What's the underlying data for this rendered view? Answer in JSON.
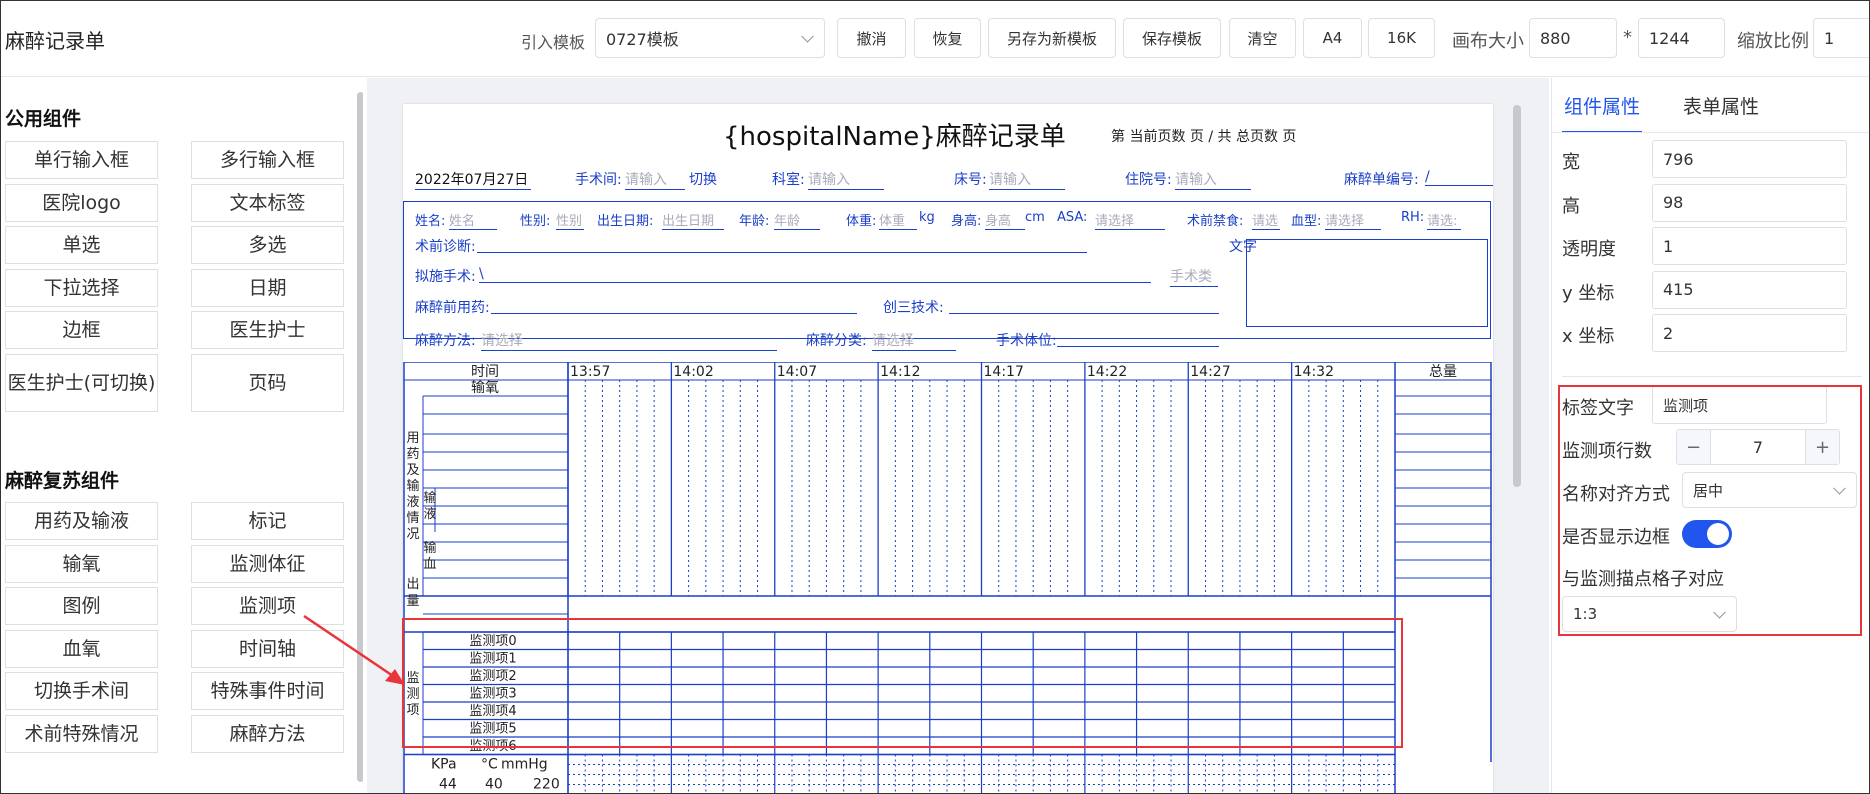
{
  "header": {
    "title": "麻醉记录单",
    "template_label": "引入模板",
    "template_value": "0727模板",
    "buttons": [
      "撤消",
      "恢复",
      "另存为新模板",
      "保存模板",
      "清空",
      "A4",
      "16K"
    ],
    "canvas_size_label": "画布大小",
    "canvas_width": "880",
    "times": "*",
    "canvas_height": "1244",
    "zoom_label": "缩放比例",
    "zoom_value": "1"
  },
  "left_panel": {
    "public_title": "公用组件",
    "public_items": [
      "单行输入框",
      "多行输入框",
      "医院logo",
      "文本标签",
      "单选",
      "多选",
      "下拉选择",
      "日期",
      "边框",
      "医生护士",
      "医生护士(可切换)",
      "页码"
    ],
    "anesthesia_title": "麻醉复苏组件",
    "anesthesia_items": [
      "用药及输液",
      "标记",
      "输氧",
      "监测体征",
      "图例",
      "监测项",
      "血氧",
      "时间轴",
      "切换手术间",
      "特殊事件时间",
      "术前特殊情况",
      "麻醉方法"
    ]
  },
  "form": {
    "title": "{hospitalName}麻醉记录单",
    "page_info": "第 当前页数 页 / 共 总页数 页",
    "date": "2022年07月27日",
    "room_label": "手术间:",
    "room_ph": "请输入",
    "switch": "切换",
    "dept_label": "科室:",
    "dept_ph": "请输入",
    "bed_label": "床号:",
    "bed_ph": "请输入",
    "inpatient_label": "住院号:",
    "inpatient_ph": "请输入",
    "record_no_label": "麻醉单编号:",
    "record_no_val": "/",
    "name_label": "姓名:",
    "name_ph": "姓名",
    "gender_label": "性别:",
    "gender_ph": "性别",
    "dob_label": "出生日期:",
    "dob_ph": "出生日期",
    "age_label": "年龄:",
    "age_ph": "年龄",
    "weight_label": "体重:",
    "weight_ph": "体重",
    "weight_unit": "kg",
    "height_label": "身高:",
    "height_ph": "身高",
    "height_unit": "cm",
    "asa_label": "ASA:",
    "asa_ph": "请选择",
    "fasting_label": "术前禁食:",
    "fasting_ph": "请选",
    "blood_label": "血型:",
    "blood_ph": "请选择",
    "rh_label": "RH:",
    "rh_ph": "请选:",
    "diag_label": "术前诊断:",
    "text_label": "文字",
    "surgery_label": "拟施手术:",
    "surgery_val": "\\",
    "surgery_type": "手术类",
    "premed_label": "麻醉前用药:",
    "invasive_label": "创三技术:",
    "method_label": "麻醉方法:",
    "method_ph": "请选择",
    "category_label": "麻醉分类:",
    "category_ph": "请选择",
    "position_label": "手术体位:",
    "time_header": "时间",
    "times": [
      "13:57",
      "14:02",
      "14:07",
      "14:12",
      "14:17",
      "14:22",
      "14:27",
      "14:32"
    ],
    "total_header": "总量",
    "oxygen": "输氧",
    "drug_section": "用药及输液情况",
    "infusion": "输液",
    "transfusion": "输血",
    "output": "出量",
    "monitor_section": "监测项",
    "monitor_items": [
      "监测项0",
      "监测项1",
      "监测项2",
      "监测项3",
      "监测项4",
      "监测项5",
      "监测项6"
    ],
    "units": [
      "KPa",
      "°C",
      "mmHg"
    ],
    "unit_values": [
      "44",
      "40",
      "220"
    ]
  },
  "right_panel": {
    "tabs": [
      "组件属性",
      "表单属性"
    ],
    "props": [
      {
        "label": "宽",
        "value": "796"
      },
      {
        "label": "高",
        "value": "98"
      },
      {
        "label": "透明度",
        "value": "1"
      },
      {
        "label": "y 坐标",
        "value": "415"
      },
      {
        "label": "x 坐标",
        "value": "2"
      }
    ],
    "label_text_label": "标签文字",
    "label_text_value": "监测项",
    "rows_label": "监测项行数",
    "rows_value": "7",
    "minus": "−",
    "plus": "+",
    "align_label": "名称对齐方式",
    "align_value": "居中",
    "border_label": "是否显示边框",
    "grid_label": "与监测描点格子对应",
    "grid_value": "1:3"
  },
  "colors": {
    "accent": "#2255ee",
    "form_line": "#1a3fc8",
    "highlight": "#e8353b"
  }
}
